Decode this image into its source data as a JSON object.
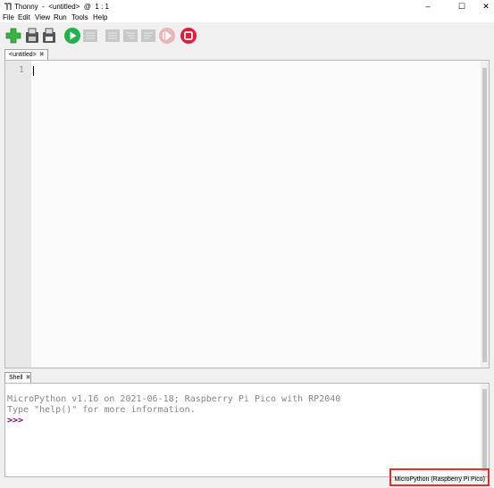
{
  "window": {
    "title": "Thonny  -  <untitled>  @  1 : 1",
    "minimize": "–",
    "maximize": "☐",
    "close": "✕"
  },
  "menu": [
    "File",
    "Edit",
    "View",
    "Run",
    "Tools",
    "Help"
  ],
  "toolbar": {
    "icons": [
      "new-file-icon",
      "open-file-icon",
      "save-file-icon",
      "run-icon",
      "debug-icon",
      "step-over-icon",
      "step-into-icon",
      "step-out-icon",
      "resume-icon",
      "stop-icon"
    ],
    "colors": {
      "new": "#3cb043",
      "run": "#22b14c",
      "stop": "#e0203a",
      "disabled": "#c8c8c8"
    }
  },
  "editor": {
    "tab_label": "<untitled>",
    "tab_close": "✖",
    "line_number": "1",
    "content": ""
  },
  "shell": {
    "tab_label": "Shell",
    "tab_close": "✖",
    "lines": [
      "MicroPython v1.16 on 2021-06-18; Raspberry Pi Pico with RP2040",
      "Type \"help()\" for more information."
    ],
    "prompt": ">>>"
  },
  "status": {
    "interpreter": "MicroPython (Raspberry Pi Pico)",
    "highlight_color": "#e53030"
  }
}
